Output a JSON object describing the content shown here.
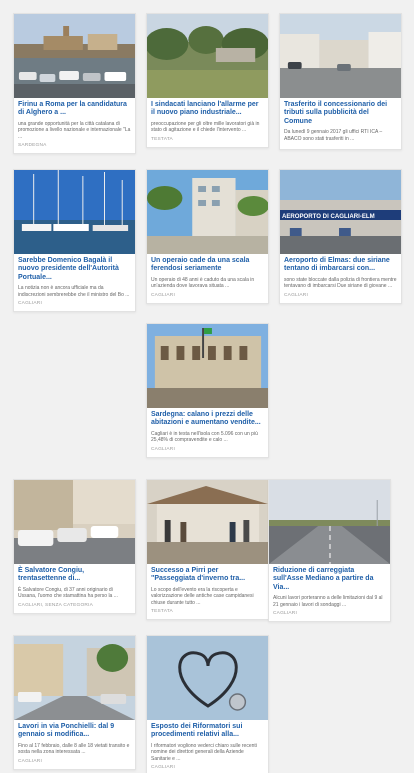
{
  "articles": [
    {
      "title": "Firinu a Roma per la candidatura di Alghero a ...",
      "excerpt": "una grande opportunità per la città catalana di promozione a livello nazionale e internazionale \"La ...",
      "category": "SARDEGNA",
      "thumb_icon": "harbor-town-photo"
    },
    {
      "title": "I sindacati lanciano l'allarme per il nuovo piano industriale...",
      "excerpt": "preoccupazione per gli oltre mille lavoratori già in stato di agitazione e il chiede l'intervento ...",
      "category": "TESTATA",
      "thumb_icon": "industrial-site-photo"
    },
    {
      "title": "Trasferito il concessionario dei tributi sulla pubblicità del Comune",
      "excerpt": "Da lunedì 9 gennaio 2017 gli uffici RTI ICA – ABACO sono stati trasferiti in ...",
      "category": "",
      "thumb_icon": "street-buildings-photo"
    },
    {
      "title": "Sarebbe Domenico Bagalà il nuovo presidente dell'Autorità Portuale...",
      "excerpt": "La notizia non è ancora ufficiale ma da indiscrezioni sembrerebbe che il ministro del Bo ...",
      "category": "CAGLIARI",
      "thumb_icon": "marina-boats-photo"
    },
    {
      "title": "Un operaio cade da una scala ferendosi seriamente",
      "excerpt": "Un operaio di 48 anni è caduto da una scala in un'azienda dove lavorava situata ...",
      "category": "CAGLIARI",
      "thumb_icon": "apartment-palms-photo"
    },
    {
      "title": "Aeroporto di Elmas: due siriane tentano di imbarcarsi con...",
      "excerpt": "sono state bloccate dalla polizia di frontiera mentre tentavano di imbarcarsi Due siriane di giovane ...",
      "category": "CAGLIARI",
      "thumb_icon": "airport-terminal-photo",
      "sign_text": "AEROPORTO DI CAGLIARI-ELM"
    },
    {
      "title": "Sardegna: calano i prezzi delle abitazioni e aumentano vendite...",
      "excerpt": "Cagliari è in testa nell'isola con 5.096 con un più 25,48% di compravendite e calo ...",
      "category": "CAGLIARI",
      "thumb_icon": "town-hall-photo"
    },
    {
      "title": "È Salvatore Congiu, trentasettenne di...",
      "excerpt": "È Salvatore Congiu, di 37 anni originario di Ussana, l'uomo che stamattina ha perso la ...",
      "category": "CAGLIARI, SENZA CATEGORIA",
      "thumb_icon": "parked-cars-street-photo"
    },
    {
      "title": "Successo a Pirri per \"Passeggiata d'inverno tra...",
      "excerpt": "Lo scopo dell'evento era la riscoperta e valorizzazione delle antiche case campidanesi chiuse durante tutto ...",
      "category": "TESTATA",
      "thumb_icon": "courtyard-visitors-photo"
    },
    {
      "title": "Riduzione di carreggiata sull'Asse Mediano a partire da Via...",
      "excerpt": "Alcuni lavori porteranno a delle limitazioni dal 9 al 21 gennaio i lavori di sondaggi ...",
      "category": "CAGLIARI",
      "thumb_icon": "highway-road-photo"
    },
    {
      "title": "Lavori in via Ponchielli: dal 9 gennaio si modifica...",
      "excerpt": "Fino al 17 febbraio, dalle 8 alle 18 vietati transito e sosta nella zona interessata ...",
      "category": "CAGLIARI",
      "thumb_icon": "residential-street-photo"
    },
    {
      "title": "Esposto dei Riformatori sui procedimenti relativi alla...",
      "excerpt": "I riformatori vogliono vederci chiaro sulle recenti nomine dei direttori generali della Aziende Sanitarie e ...",
      "category": "CAGLIARI",
      "thumb_icon": "stethoscope-heart-photo"
    }
  ]
}
